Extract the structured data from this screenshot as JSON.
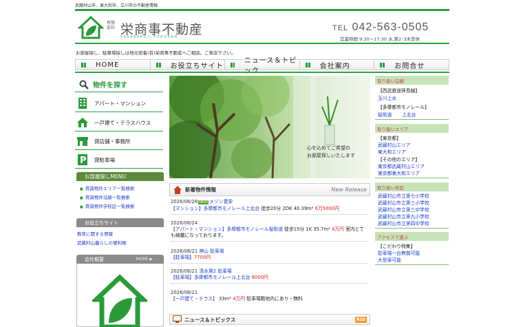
{
  "header": {
    "topline": "武蔵村山市、東大和市、立川市の不動産情報",
    "logo_company_type": "有限会社",
    "logo_name": "栄商事不動産",
    "logo_roman": "SAKAESHOJI FUDOSAN",
    "tel_prefix": "TEL",
    "tel_number": "042-563-0505",
    "hours": "営業時間 9:30〜17:30 水,第2･3木定休",
    "tagline": "お部屋探し、駐車場探しは地元密着(有)栄商事不動産へご相談。ご来店下さい。"
  },
  "nav": {
    "items": [
      {
        "label": "HOME"
      },
      {
        "label": "お役立ちサイト"
      },
      {
        "label": "ニュース＆トピック"
      },
      {
        "label": "会社案内"
      },
      {
        "label": "お問合せ"
      }
    ]
  },
  "left": {
    "search_title": "物件を探す",
    "categories": [
      {
        "label": "アパート・マンション",
        "icon": "apartment-icon"
      },
      {
        "label": "一戸建て・テラスハウス",
        "icon": "house-icon"
      },
      {
        "label": "貸店舗・事務所",
        "icon": "store-icon"
      },
      {
        "label": "貸駐車場",
        "icon": "parking-icon"
      }
    ],
    "menu_title": "お部屋探しMENU",
    "menu_links": [
      "賃貸物件エリア一覧検索",
      "賃貸物件沿線一覧検索",
      "賃貸物件学校区一覧検索"
    ],
    "useful_title": "お役立ちサイト",
    "useful_links": [
      "教育に関する情報",
      "武蔵村山暮らしの便利帳"
    ],
    "company_title": "会社概要",
    "company_more": "MORE ▶"
  },
  "hero": {
    "message_line1": "心を込めてご希望の",
    "message_line2": "お部屋探しいたします"
  },
  "new_release": {
    "title": "新着物件情報",
    "en": "New Release",
    "entries": [
      {
        "date": "2026/08/28",
        "new": "NEW",
        "name": "メゾン豊栄",
        "cat": "【マンション】",
        "route": "多摩都市モノレール上北台",
        "detail": "徒歩20分 2DK 40.39m²",
        "price": "6万5000円",
        "extra": ""
      },
      {
        "date": "2026/08/24",
        "new": "",
        "name": "",
        "cat": "【アパート・マンション】",
        "route": "多摩都市モノレール桜街道",
        "detail": "徒歩15分 1K 35.7m²",
        "price": "4万円",
        "extra": "室内とても綺麗になっております。"
      },
      {
        "date": "2026/08/21",
        "new": "",
        "name": "神山 駐車場",
        "cat": "【駐車場】",
        "route": "",
        "detail": "",
        "price": "7700円",
        "extra": ""
      },
      {
        "date": "2026/08/21",
        "new": "",
        "name": "清水第2 駐車場",
        "cat": "【駐車場】",
        "route": "多摩都市モノレール上北台",
        "detail": "",
        "price": "8000円",
        "extra": ""
      },
      {
        "date": "2026/08/21",
        "new": "",
        "name": "",
        "cat": "【一戸建て・テラス】",
        "route": "",
        "detail": "33m²",
        "price": "4万円",
        "extra": "駐車場敷地内にあり・無料"
      }
    ]
  },
  "news": {
    "title": "ニュース＆トピックス",
    "rss": "RSS"
  },
  "right": {
    "lines_title": "取り扱い沿線",
    "lines": [
      {
        "name": "【西武鉄道拝島線】",
        "links": [
          "玉川上水"
        ]
      },
      {
        "name": "【多摩都市モノレール】",
        "links": [
          "桜街道",
          "上北台"
        ]
      }
    ],
    "area_title": "取り扱いエリア",
    "area_tokyo": "【東京都】",
    "area_links": [
      "武蔵村山エリア",
      "東大和エリア"
    ],
    "area_other": "【その他のエリア】",
    "area_other_links": [
      "東京都武蔵村山エリア",
      "東京都東大和エリア"
    ],
    "school_title": "取り扱い校区",
    "schools": [
      "武蔵村山市立第七小学校",
      "武蔵村山市立第三小学校",
      "武蔵村山市立第三中学校",
      "武蔵村山市立第九小学校",
      "武蔵村山市立第四中学校"
    ],
    "access_title": "アクセスで選ぶ",
    "feature_title": "【こだわり特集】",
    "features": [
      "駐車場一台無償可能",
      "大型車可能"
    ]
  }
}
